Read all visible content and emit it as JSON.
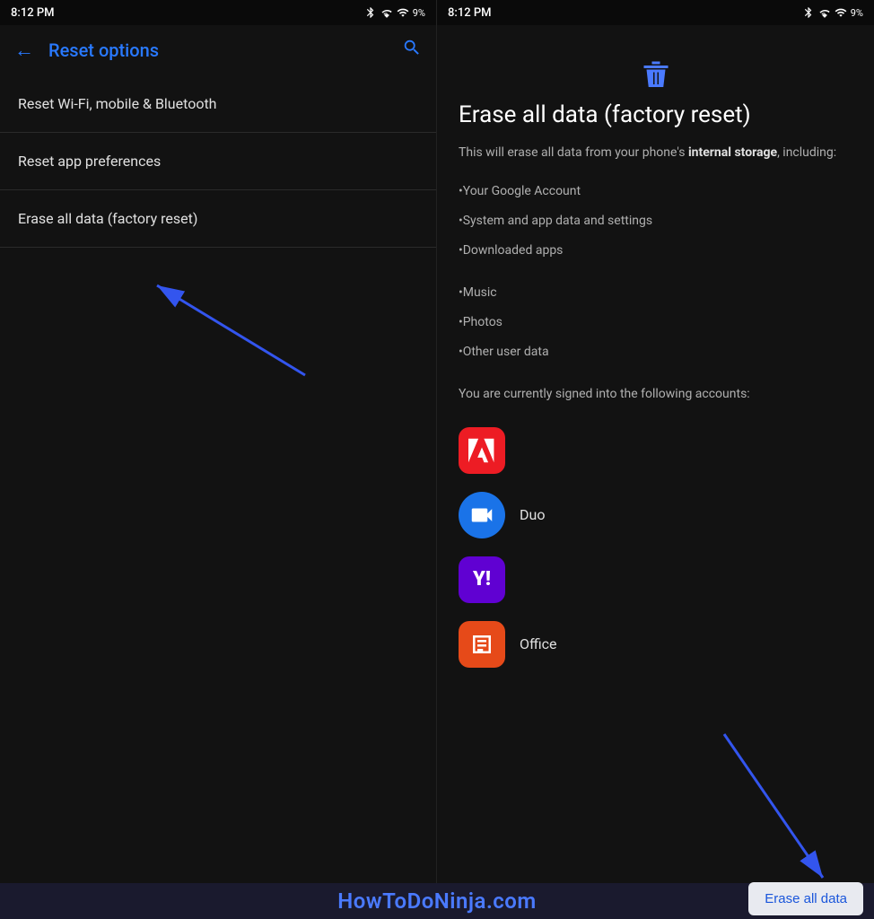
{
  "status_bar_left": {
    "time": "8:12 PM",
    "icons": "🔵 ▼ 📶 9%"
  },
  "status_bar_right": {
    "time": "8:12 PM",
    "icons": "🔵 ▼ 📶 9%"
  },
  "left_panel": {
    "back_label": "←",
    "title": "Reset options",
    "search_icon": "search",
    "menu_items": [
      {
        "label": "Reset Wi-Fi, mobile & Bluetooth"
      },
      {
        "label": "Reset app preferences"
      },
      {
        "label": "Erase all data (factory reset)"
      }
    ]
  },
  "right_panel": {
    "trash_icon": "trash",
    "title": "Erase all data (factory reset)",
    "description_plain": "This will erase all data from your phone's ",
    "description_bold": "internal storage",
    "description_suffix": ", including:",
    "bullet_items": [
      "•Your Google Account",
      "•System and app data and settings",
      "•Downloaded apps",
      "•Music",
      "•Photos",
      "•Other user data"
    ],
    "signed_in_text": "You are currently signed into the following accounts:",
    "accounts": [
      {
        "name": "",
        "icon_type": "adobe"
      },
      {
        "name": "Duo",
        "icon_type": "duo"
      },
      {
        "name": "",
        "icon_type": "yahoo"
      },
      {
        "name": "Office",
        "icon_type": "office"
      }
    ],
    "erase_button_label": "Erase all data"
  },
  "watermark": {
    "text": "HowToDoNinja.com"
  },
  "colors": {
    "accent": "#2979ff",
    "background": "#121212",
    "text_primary": "#e0e0e0",
    "text_secondary": "#b0b0b0"
  }
}
